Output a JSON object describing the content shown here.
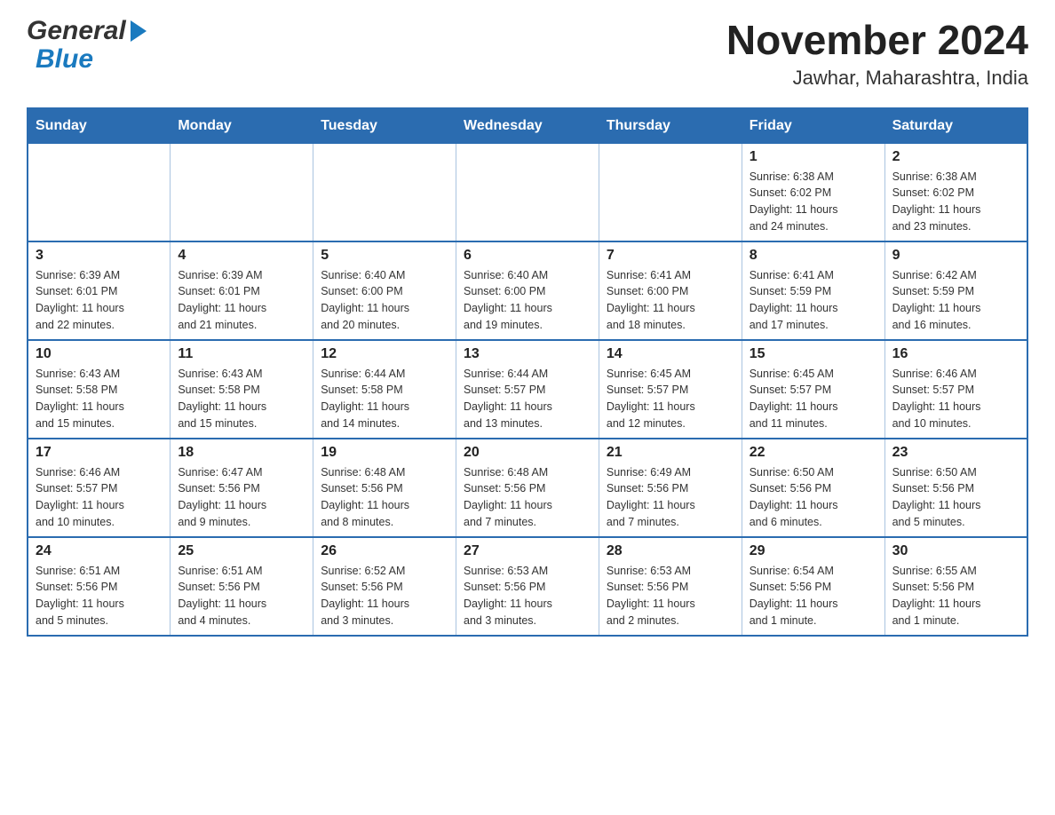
{
  "header": {
    "logo_general": "General",
    "logo_blue": "Blue",
    "month_title": "November 2024",
    "location": "Jawhar, Maharashtra, India"
  },
  "weekdays": [
    "Sunday",
    "Monday",
    "Tuesday",
    "Wednesday",
    "Thursday",
    "Friday",
    "Saturday"
  ],
  "weeks": [
    [
      {
        "day": "",
        "info": ""
      },
      {
        "day": "",
        "info": ""
      },
      {
        "day": "",
        "info": ""
      },
      {
        "day": "",
        "info": ""
      },
      {
        "day": "",
        "info": ""
      },
      {
        "day": "1",
        "info": "Sunrise: 6:38 AM\nSunset: 6:02 PM\nDaylight: 11 hours\nand 24 minutes."
      },
      {
        "day": "2",
        "info": "Sunrise: 6:38 AM\nSunset: 6:02 PM\nDaylight: 11 hours\nand 23 minutes."
      }
    ],
    [
      {
        "day": "3",
        "info": "Sunrise: 6:39 AM\nSunset: 6:01 PM\nDaylight: 11 hours\nand 22 minutes."
      },
      {
        "day": "4",
        "info": "Sunrise: 6:39 AM\nSunset: 6:01 PM\nDaylight: 11 hours\nand 21 minutes."
      },
      {
        "day": "5",
        "info": "Sunrise: 6:40 AM\nSunset: 6:00 PM\nDaylight: 11 hours\nand 20 minutes."
      },
      {
        "day": "6",
        "info": "Sunrise: 6:40 AM\nSunset: 6:00 PM\nDaylight: 11 hours\nand 19 minutes."
      },
      {
        "day": "7",
        "info": "Sunrise: 6:41 AM\nSunset: 6:00 PM\nDaylight: 11 hours\nand 18 minutes."
      },
      {
        "day": "8",
        "info": "Sunrise: 6:41 AM\nSunset: 5:59 PM\nDaylight: 11 hours\nand 17 minutes."
      },
      {
        "day": "9",
        "info": "Sunrise: 6:42 AM\nSunset: 5:59 PM\nDaylight: 11 hours\nand 16 minutes."
      }
    ],
    [
      {
        "day": "10",
        "info": "Sunrise: 6:43 AM\nSunset: 5:58 PM\nDaylight: 11 hours\nand 15 minutes."
      },
      {
        "day": "11",
        "info": "Sunrise: 6:43 AM\nSunset: 5:58 PM\nDaylight: 11 hours\nand 15 minutes."
      },
      {
        "day": "12",
        "info": "Sunrise: 6:44 AM\nSunset: 5:58 PM\nDaylight: 11 hours\nand 14 minutes."
      },
      {
        "day": "13",
        "info": "Sunrise: 6:44 AM\nSunset: 5:57 PM\nDaylight: 11 hours\nand 13 minutes."
      },
      {
        "day": "14",
        "info": "Sunrise: 6:45 AM\nSunset: 5:57 PM\nDaylight: 11 hours\nand 12 minutes."
      },
      {
        "day": "15",
        "info": "Sunrise: 6:45 AM\nSunset: 5:57 PM\nDaylight: 11 hours\nand 11 minutes."
      },
      {
        "day": "16",
        "info": "Sunrise: 6:46 AM\nSunset: 5:57 PM\nDaylight: 11 hours\nand 10 minutes."
      }
    ],
    [
      {
        "day": "17",
        "info": "Sunrise: 6:46 AM\nSunset: 5:57 PM\nDaylight: 11 hours\nand 10 minutes."
      },
      {
        "day": "18",
        "info": "Sunrise: 6:47 AM\nSunset: 5:56 PM\nDaylight: 11 hours\nand 9 minutes."
      },
      {
        "day": "19",
        "info": "Sunrise: 6:48 AM\nSunset: 5:56 PM\nDaylight: 11 hours\nand 8 minutes."
      },
      {
        "day": "20",
        "info": "Sunrise: 6:48 AM\nSunset: 5:56 PM\nDaylight: 11 hours\nand 7 minutes."
      },
      {
        "day": "21",
        "info": "Sunrise: 6:49 AM\nSunset: 5:56 PM\nDaylight: 11 hours\nand 7 minutes."
      },
      {
        "day": "22",
        "info": "Sunrise: 6:50 AM\nSunset: 5:56 PM\nDaylight: 11 hours\nand 6 minutes."
      },
      {
        "day": "23",
        "info": "Sunrise: 6:50 AM\nSunset: 5:56 PM\nDaylight: 11 hours\nand 5 minutes."
      }
    ],
    [
      {
        "day": "24",
        "info": "Sunrise: 6:51 AM\nSunset: 5:56 PM\nDaylight: 11 hours\nand 5 minutes."
      },
      {
        "day": "25",
        "info": "Sunrise: 6:51 AM\nSunset: 5:56 PM\nDaylight: 11 hours\nand 4 minutes."
      },
      {
        "day": "26",
        "info": "Sunrise: 6:52 AM\nSunset: 5:56 PM\nDaylight: 11 hours\nand 3 minutes."
      },
      {
        "day": "27",
        "info": "Sunrise: 6:53 AM\nSunset: 5:56 PM\nDaylight: 11 hours\nand 3 minutes."
      },
      {
        "day": "28",
        "info": "Sunrise: 6:53 AM\nSunset: 5:56 PM\nDaylight: 11 hours\nand 2 minutes."
      },
      {
        "day": "29",
        "info": "Sunrise: 6:54 AM\nSunset: 5:56 PM\nDaylight: 11 hours\nand 1 minute."
      },
      {
        "day": "30",
        "info": "Sunrise: 6:55 AM\nSunset: 5:56 PM\nDaylight: 11 hours\nand 1 minute."
      }
    ]
  ]
}
